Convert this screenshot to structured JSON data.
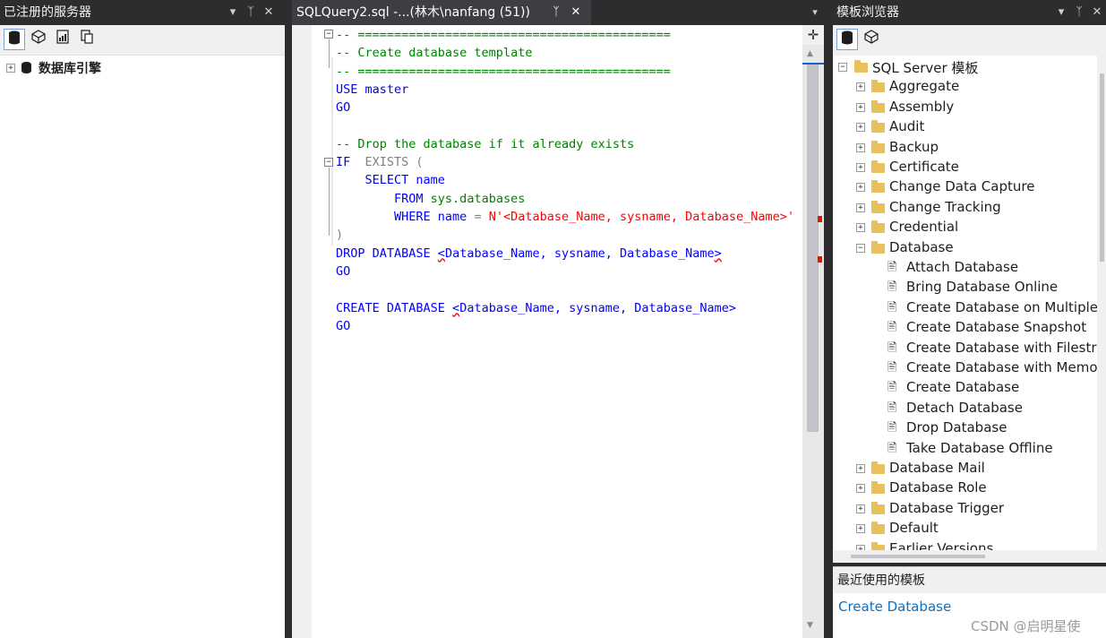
{
  "left_panel": {
    "title": "已注册的服务器",
    "controls": {
      "dropdown": "▾",
      "pin": "ᛉ",
      "close": "✕"
    },
    "toolbar": [
      "database-engine-tool",
      "analysis-services-tool",
      "reporting-services-tool",
      "integration-services-tool"
    ],
    "tree": [
      {
        "label": "数据库引擎",
        "expander": "+"
      }
    ]
  },
  "editor": {
    "tab_title": "SQLQuery2.sql -...(林木\\nanfang (51))",
    "tab_pin": "ᛉ",
    "tab_close": "✕",
    "overflow_dropdown": "▾",
    "split_button": "✛",
    "lines": [
      [
        {
          "t": "-- ===========================================",
          "c": "com"
        }
      ],
      [
        {
          "t": "-- Create database template",
          "c": "com"
        }
      ],
      [
        {
          "t": "-- ===========================================",
          "c": "com"
        }
      ],
      [
        {
          "t": "USE",
          "c": "kw"
        },
        {
          "t": " master",
          "c": "kw"
        }
      ],
      [
        {
          "t": "GO",
          "c": "kw"
        }
      ],
      [],
      [
        {
          "t": "-- Drop the database if it already exists",
          "c": "com"
        }
      ],
      [
        {
          "t": "IF",
          "c": "kw"
        },
        {
          "t": "  EXISTS (",
          "c": "gray"
        }
      ],
      [
        {
          "t": "    SELECT",
          "c": "kw"
        },
        {
          "t": " name",
          "c": "kw"
        }
      ],
      [
        {
          "t": "        FROM",
          "c": "kw"
        },
        {
          "t": " sys.databases",
          "c": "sys"
        }
      ],
      [
        {
          "t": "        WHERE",
          "c": "kw"
        },
        {
          "t": " name",
          "c": "kw"
        },
        {
          "t": " = ",
          "c": "gray"
        },
        {
          "t": "N'<Database_Name, sysname, Database_Name>'",
          "c": "str"
        }
      ],
      [
        {
          "t": ")",
          "c": "gray"
        }
      ],
      [
        {
          "t": "DROP DATABASE ",
          "c": "kw"
        },
        {
          "t": "<",
          "c": "tpl",
          "sq": true
        },
        {
          "t": "Database_Name, sysname, Database_Name",
          "c": "tpl"
        },
        {
          "t": ">",
          "c": "tpl",
          "sq": true
        }
      ],
      [
        {
          "t": "GO",
          "c": "kw"
        }
      ],
      [],
      [
        {
          "t": "CREATE DATABASE ",
          "c": "kw"
        },
        {
          "t": "<",
          "c": "tpl",
          "sq": true
        },
        {
          "t": "Database_Name, sysname, Database_Name>",
          "c": "tpl"
        }
      ],
      [
        {
          "t": "GO",
          "c": "kw"
        }
      ]
    ]
  },
  "right_panel": {
    "title": "模板浏览器",
    "controls": {
      "dropdown": "▾",
      "pin": "ᛉ",
      "close": "✕"
    },
    "toolbar": [
      "sql-server-templates-tool",
      "analysis-services-templates-tool"
    ],
    "root": {
      "label": "SQL Server 模板",
      "expander": "−"
    },
    "folders": [
      {
        "label": "Aggregate",
        "expander": "+"
      },
      {
        "label": "Assembly",
        "expander": "+"
      },
      {
        "label": "Audit",
        "expander": "+"
      },
      {
        "label": "Backup",
        "expander": "+"
      },
      {
        "label": "Certificate",
        "expander": "+"
      },
      {
        "label": "Change Data Capture",
        "expander": "+"
      },
      {
        "label": "Change Tracking",
        "expander": "+"
      },
      {
        "label": "Credential",
        "expander": "+"
      },
      {
        "label": "Database",
        "expander": "−",
        "children": [
          "Attach Database",
          "Bring Database Online",
          "Create Database on Multiple",
          "Create Database Snapshot",
          "Create Database with Filestre",
          "Create Database with Memor",
          "Create Database",
          "Detach Database",
          "Drop Database",
          "Take Database Offline"
        ]
      },
      {
        "label": "Database Mail",
        "expander": "+"
      },
      {
        "label": "Database Role",
        "expander": "+"
      },
      {
        "label": "Database Trigger",
        "expander": "+"
      },
      {
        "label": "Default",
        "expander": "+"
      },
      {
        "label": "Earlier Versions",
        "expander": "+"
      }
    ],
    "recent_header": "最近使用的模板",
    "recent_items": [
      "Create Database"
    ]
  },
  "watermark": "CSDN @启明星使",
  "colors": {
    "chrome_dark": "#2d2d30",
    "comment": "#008000",
    "keyword": "#0000ff",
    "string": "#ff0000",
    "link": "#0e70c0",
    "folder": "#e8c15a",
    "error_marker": "#e51400"
  }
}
